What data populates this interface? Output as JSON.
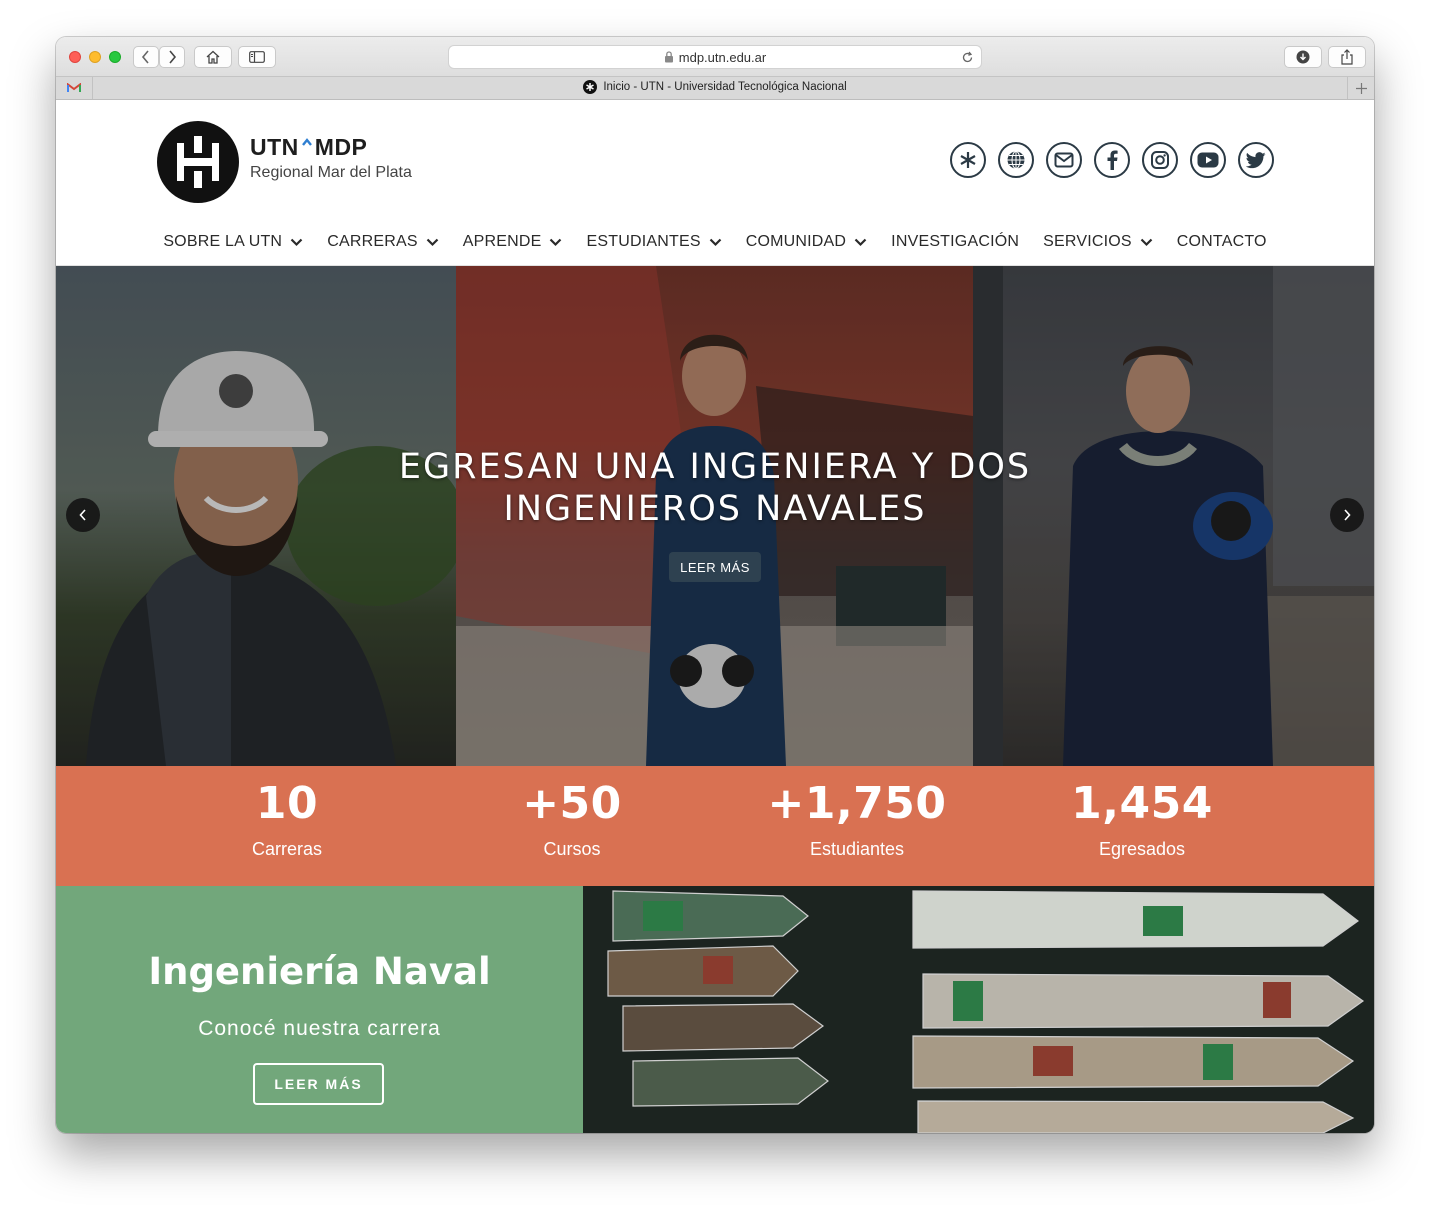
{
  "browser": {
    "url": "mdp.utn.edu.ar",
    "tab_title": "Inicio - UTN - Universidad Tecnológica Nacional"
  },
  "brand": {
    "name_left": "UTN",
    "name_right": "MDP",
    "subtitle": "Regional Mar del Plata"
  },
  "social_icons": [
    "utn-icon",
    "globe-icon",
    "mail-icon",
    "facebook-icon",
    "instagram-icon",
    "youtube-icon",
    "twitter-icon"
  ],
  "nav": {
    "items": [
      {
        "label": "SOBRE LA UTN",
        "dropdown": true
      },
      {
        "label": "CARRERAS",
        "dropdown": true
      },
      {
        "label": "APRENDE",
        "dropdown": true
      },
      {
        "label": "ESTUDIANTES",
        "dropdown": true
      },
      {
        "label": "COMUNIDAD",
        "dropdown": true
      },
      {
        "label": "INVESTIGACIÓN",
        "dropdown": false
      },
      {
        "label": "SERVICIOS",
        "dropdown": true
      },
      {
        "label": "CONTACTO",
        "dropdown": false
      }
    ]
  },
  "hero": {
    "title_line1": "EGRESAN UNA INGENIERA Y DOS",
    "title_line2": "INGENIEROS NAVALES",
    "button": "LEER MÁS"
  },
  "stats": [
    {
      "value": "10",
      "label": "Carreras"
    },
    {
      "value": "+50",
      "label": "Cursos"
    },
    {
      "value": "+1,750",
      "label": "Estudiantes"
    },
    {
      "value": "1,454",
      "label": "Egresados"
    }
  ],
  "feature": {
    "title": "Ingeniería Naval",
    "subtitle": "Conocé nuestra carrera",
    "button": "LEER MÁS"
  },
  "colors": {
    "stats_bg": "#d97152",
    "feature_bg": "#72a77b",
    "nav_text": "#2a2a2a",
    "icon_stroke": "#2b3a45"
  }
}
